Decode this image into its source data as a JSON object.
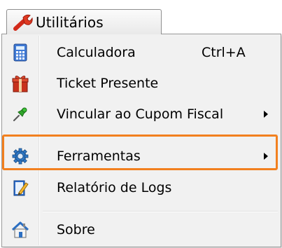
{
  "menubar": {
    "tab_label": "Utilitários",
    "tab_icon": "wrench-icon"
  },
  "menu": {
    "items": [
      {
        "label": "Calculadora",
        "shortcut": "Ctrl+A",
        "icon": "calculator-icon",
        "submenu": false
      },
      {
        "label": "Ticket Presente",
        "shortcut": "",
        "icon": "gift-icon",
        "submenu": false
      },
      {
        "label": "Vincular ao Cupom Fiscal",
        "shortcut": "",
        "icon": "pushpin-icon",
        "submenu": true
      },
      {
        "label": "Ferramentas",
        "shortcut": "",
        "icon": "gear-icon",
        "submenu": true
      },
      {
        "label": "Relatório de Logs",
        "shortcut": "",
        "icon": "notepad-pencil-icon",
        "submenu": false,
        "highlighted": true
      },
      {
        "label": "Sobre",
        "shortcut": "",
        "icon": "home-icon",
        "submenu": false
      }
    ]
  },
  "colors": {
    "highlight_border": "#f2801f",
    "menu_background": "#f1f1f1"
  }
}
